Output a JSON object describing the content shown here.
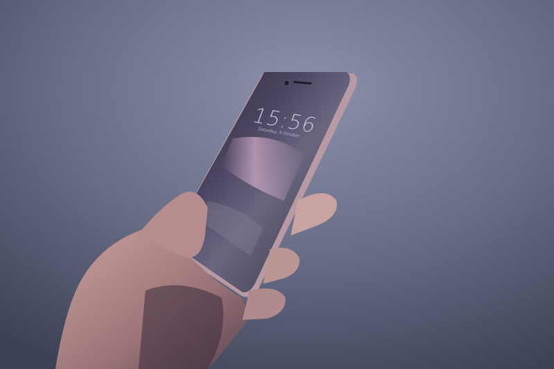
{
  "lock_screen": {
    "time": "15:56",
    "date": "Saturday, 6 October"
  },
  "colors": {
    "background": "#4a5068",
    "phone_body": "#2c2a3a",
    "skin_tone": "#c49a94",
    "screen_glare": "#cfa9c8"
  }
}
